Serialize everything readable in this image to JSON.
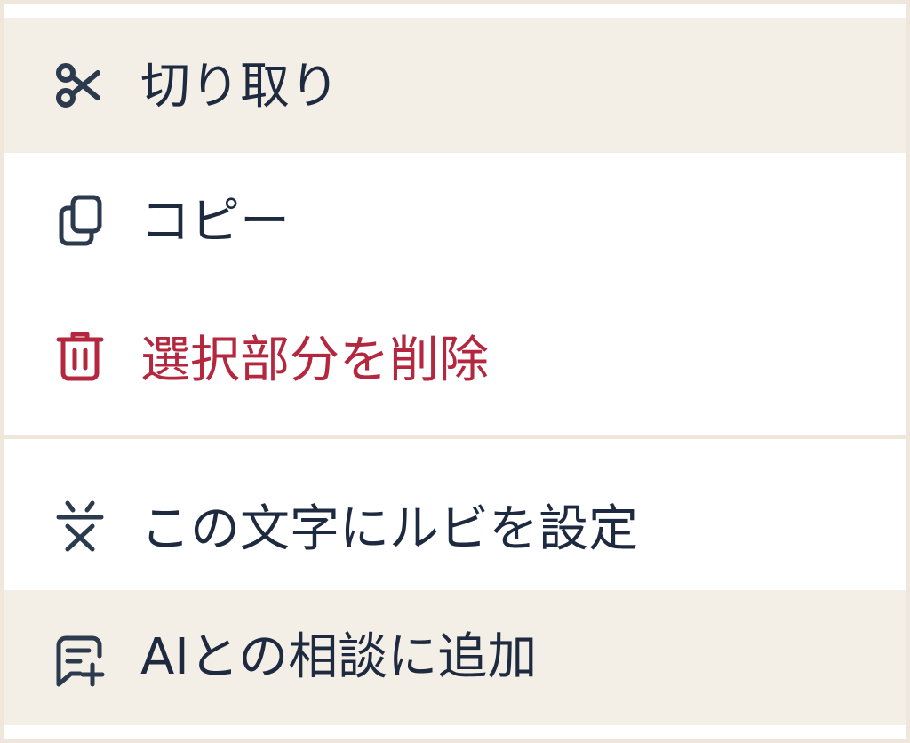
{
  "menu": {
    "items": [
      {
        "label": "切り取り",
        "icon": "scissors-icon",
        "highlighted": true
      },
      {
        "label": "コピー",
        "icon": "copy-icon",
        "highlighted": false
      },
      {
        "label": "選択部分を削除",
        "icon": "trash-icon",
        "highlighted": false,
        "color": "#b3283f"
      },
      {
        "label": "この文字にルビを設定",
        "icon": "ruby-icon",
        "highlighted": false
      },
      {
        "label": "AIとの相談に追加",
        "icon": "chat-add-icon",
        "highlighted": true
      }
    ]
  },
  "colors": {
    "text": "#1e2a3f",
    "danger": "#b3283f",
    "highlight": "#f3eee6",
    "border": "#efe6dc"
  }
}
